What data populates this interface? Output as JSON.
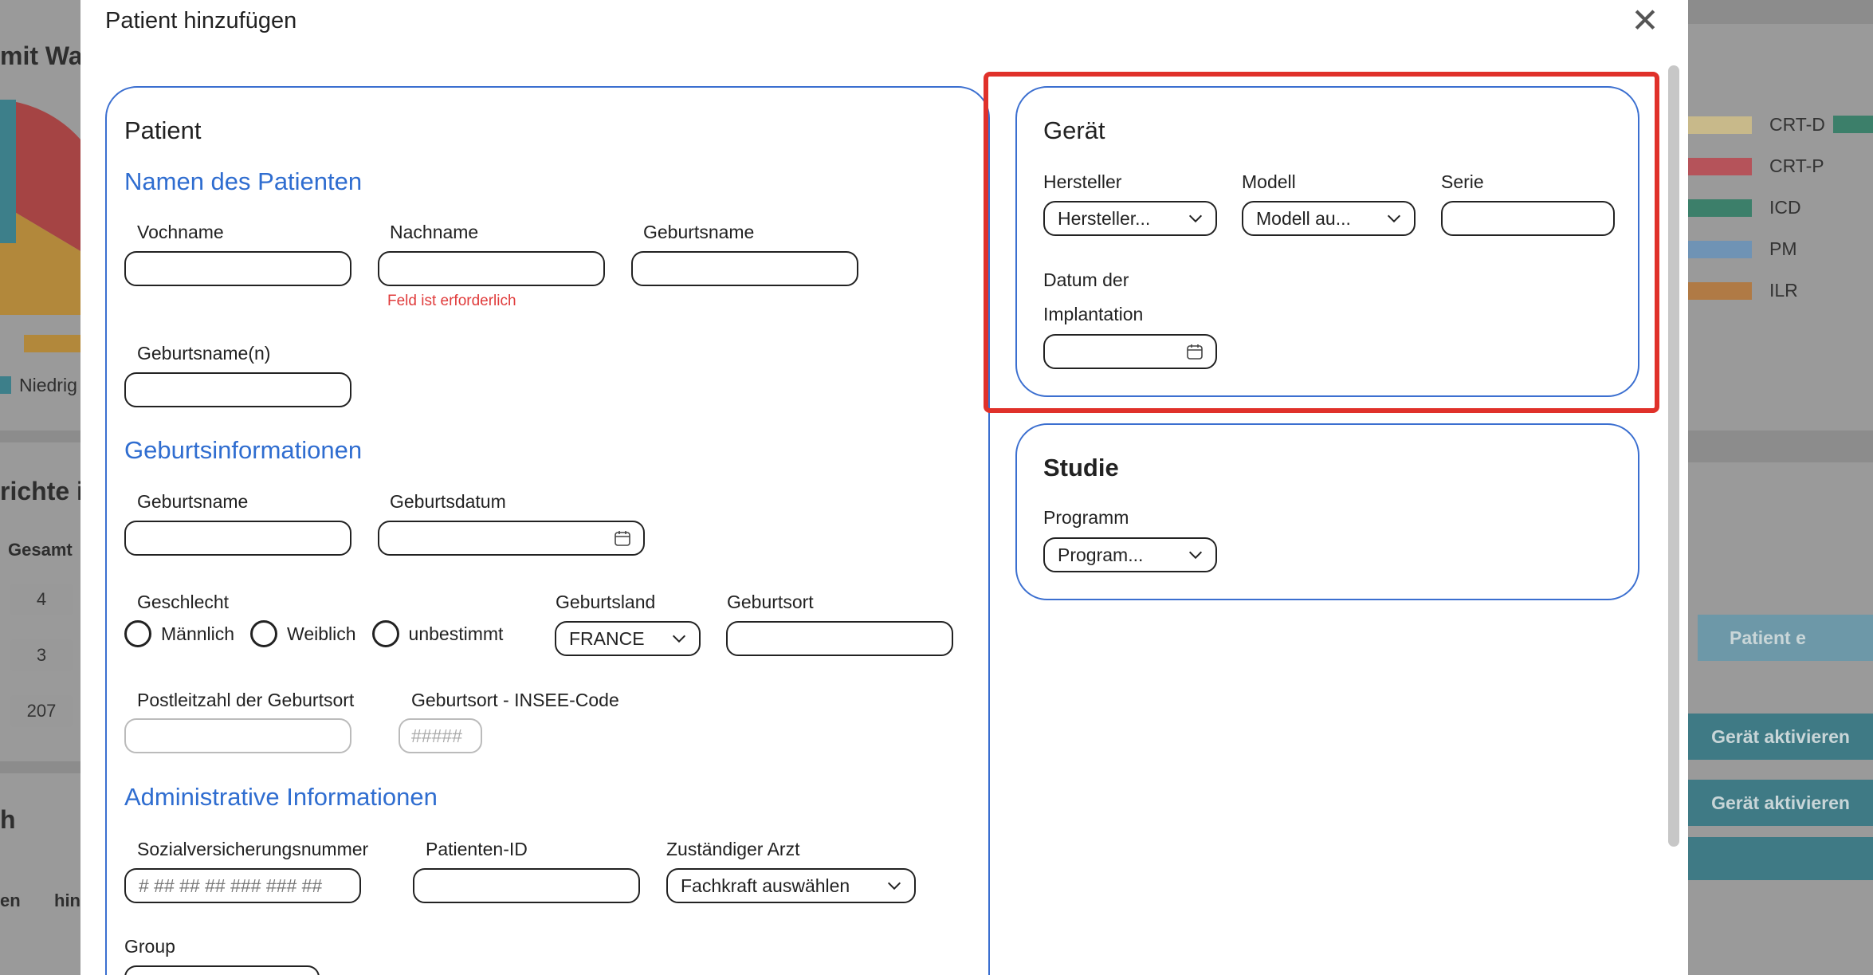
{
  "background": {
    "title_fragment": "mit War",
    "heading_fragment": "richte i",
    "column_gesamt": "Gesamt",
    "values": [
      "4",
      "3",
      "207"
    ],
    "legend_left": "Niedrig",
    "fragment_h": "h",
    "fragment_en": "en",
    "fragment_hin": "hin",
    "legend": [
      {
        "label": "CRT-D",
        "color": "#c8b98a"
      },
      {
        "label": "CRT-P",
        "color": "#b5535a"
      },
      {
        "label": "ICD",
        "color": "#3c7f6a"
      },
      {
        "label": "PM",
        "color": "#6f93b5"
      },
      {
        "label": "ILR",
        "color": "#b07a45"
      }
    ],
    "patient_button": "Patient e",
    "activate_buttons": [
      "Gerät aktivieren",
      "Gerät aktivieren"
    ]
  },
  "modal": {
    "title": "Patient hinzufügen",
    "close_glyph": "✕"
  },
  "patient": {
    "title": "Patient",
    "names_section": "Namen des Patienten",
    "firstname_label": "Vochname",
    "lastname_label": "Nachname",
    "lastname_error": "Feld ist erforderlich",
    "birthname_label": "Geburtsname",
    "birthnames_label": "Geburtsname(n)",
    "birth_section": "Geburtsinformationen",
    "birth_name_label": "Geburtsname",
    "birthdate_label": "Geburtsdatum",
    "gender_label": "Geschlecht",
    "gender_options": [
      "Männlich",
      "Weiblich",
      "unbestimmt"
    ],
    "birth_country_label": "Geburtsland",
    "birth_country_value": "FRANCE",
    "birth_place_label": "Geburtsort",
    "postal_code_label": "Postleitzahl der Geburtsort",
    "insee_label": "Geburtsort - INSEE-Code",
    "insee_placeholder": "#####",
    "admin_section": "Administrative Informationen",
    "ssn_label": "Sozialversicherungsnummer",
    "ssn_placeholder": "# ## ## ## ### ### ##",
    "patient_id_label": "Patienten-ID",
    "doctor_label": "Zuständiger Arzt",
    "doctor_value": "Fachkraft auswählen",
    "group_label": "Group"
  },
  "device": {
    "title": "Gerät",
    "manufacturer_label": "Hersteller",
    "manufacturer_value": "Hersteller...",
    "model_label": "Modell",
    "model_value": "Modell au...",
    "serial_label": "Serie",
    "implant_date_label_1": "Datum der",
    "implant_date_label_2": "Implantation"
  },
  "study": {
    "title": "Studie",
    "program_label": "Programm",
    "program_value": "Program..."
  },
  "colors": {
    "accent_blue": "#2f6dd0",
    "error_red": "#e03b3b",
    "highlight_red": "#e0312a"
  }
}
